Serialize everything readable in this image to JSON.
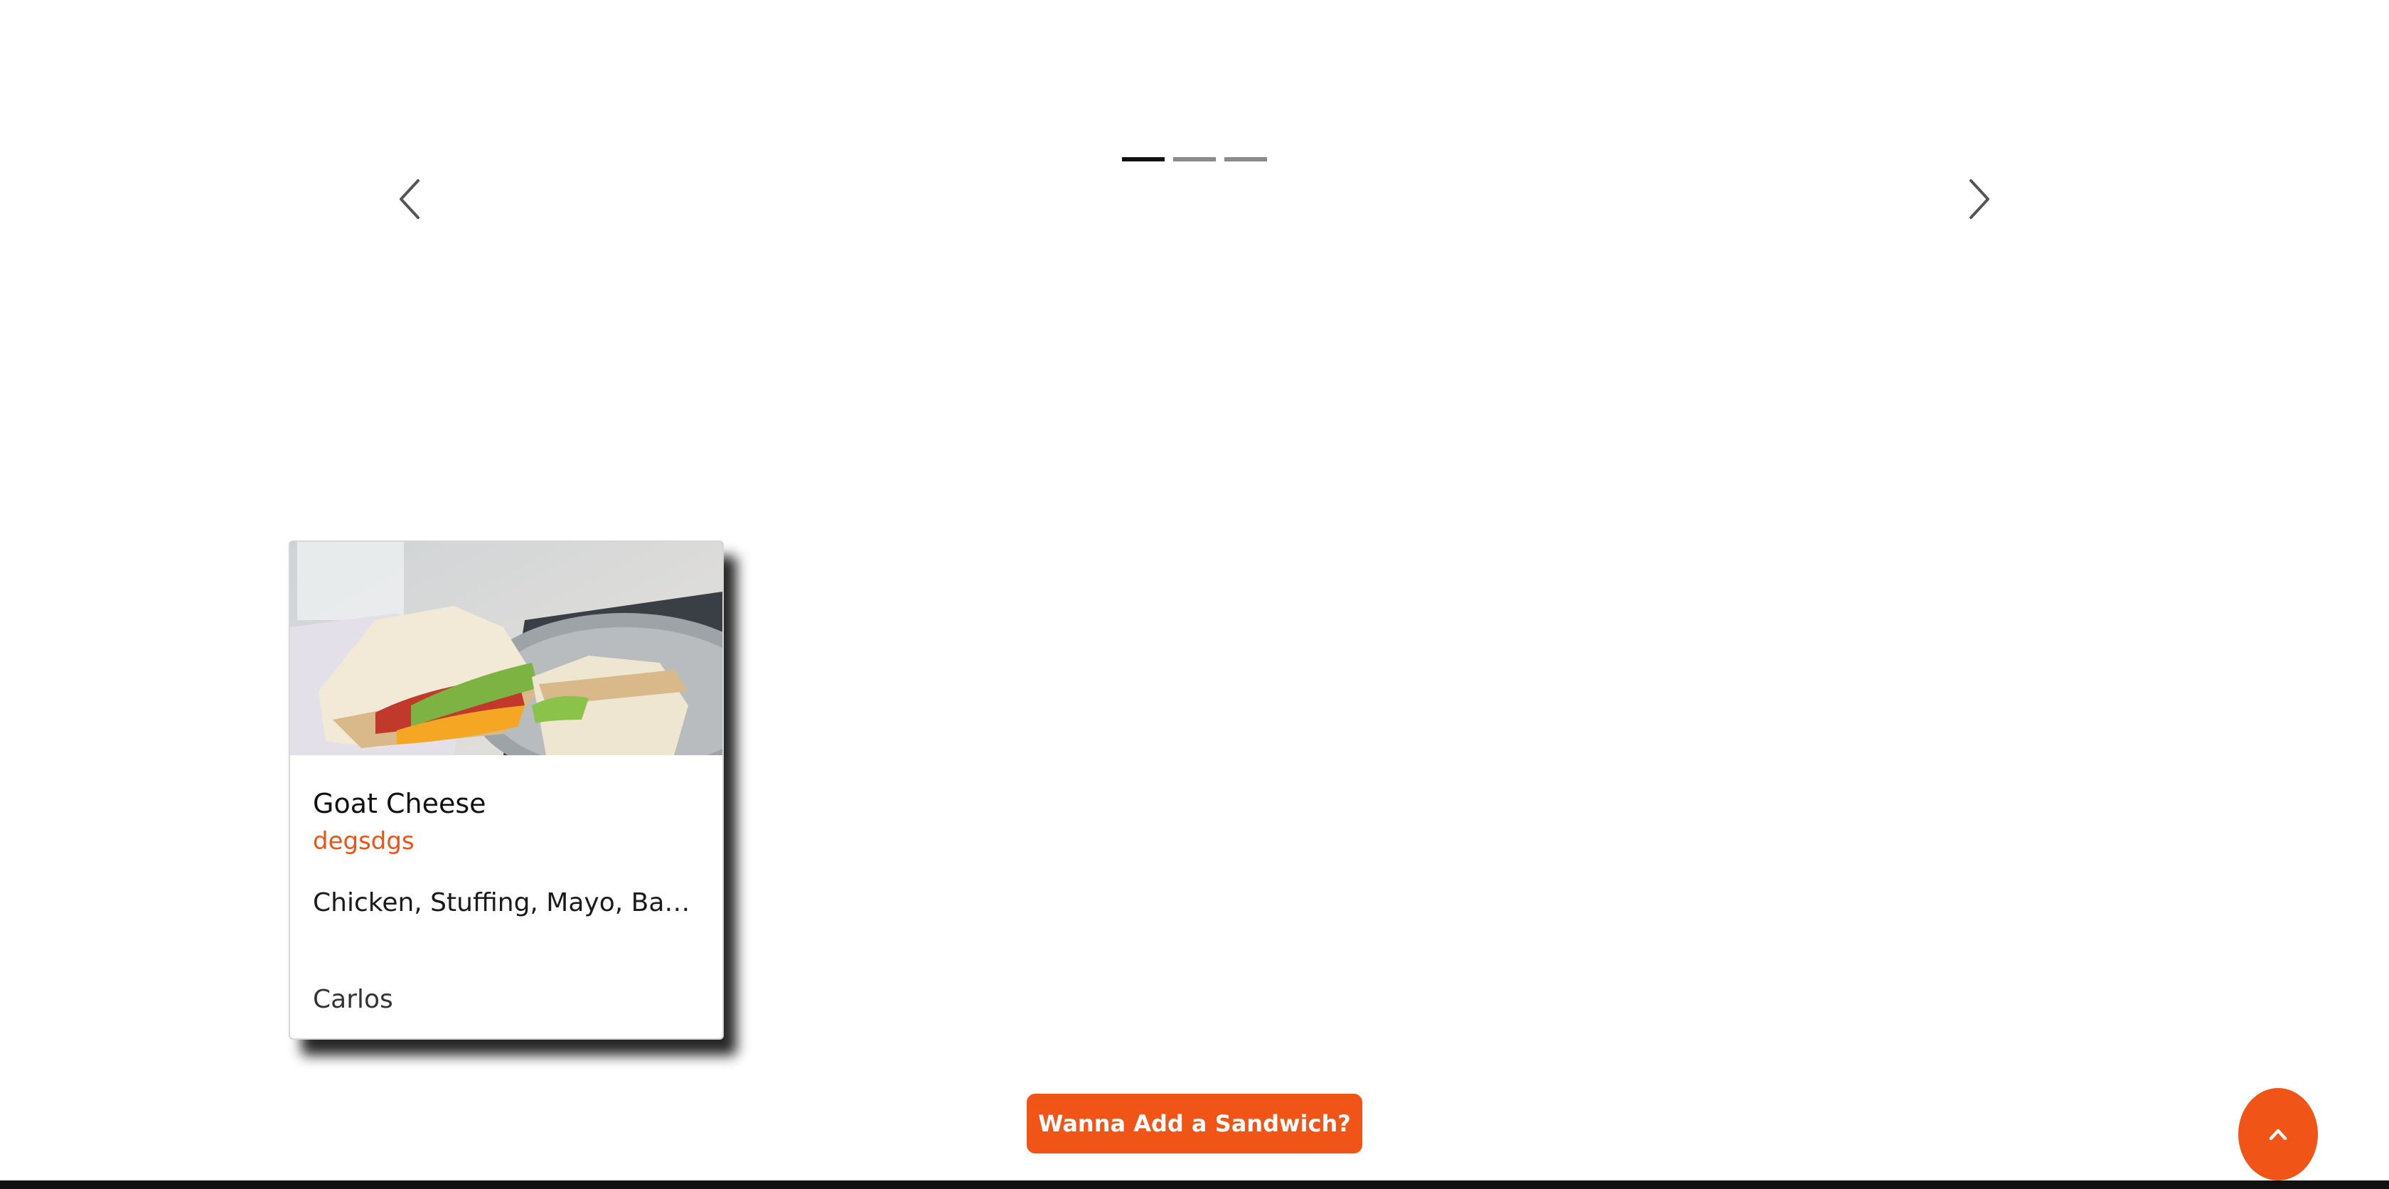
{
  "carousel": {
    "indicators": [
      {
        "active": true
      },
      {
        "active": false
      },
      {
        "active": false
      }
    ],
    "prev_icon": "chevron-left-icon",
    "next_icon": "chevron-right-icon"
  },
  "card": {
    "image_alt": "sandwich-photo",
    "title": "Goat Cheese",
    "subtitle": "degsdgs",
    "ingredients": "Chicken, Stuffing, Mayo, Bac...",
    "author": "Carlos"
  },
  "actions": {
    "add_sandwich_label": "Wanna Add a Sandwich?",
    "scroll_top_icon": "chevron-up-icon"
  },
  "colors": {
    "accent": "#f05417",
    "indicator_active": "#111111",
    "indicator_inactive": "#8a8a8a"
  }
}
